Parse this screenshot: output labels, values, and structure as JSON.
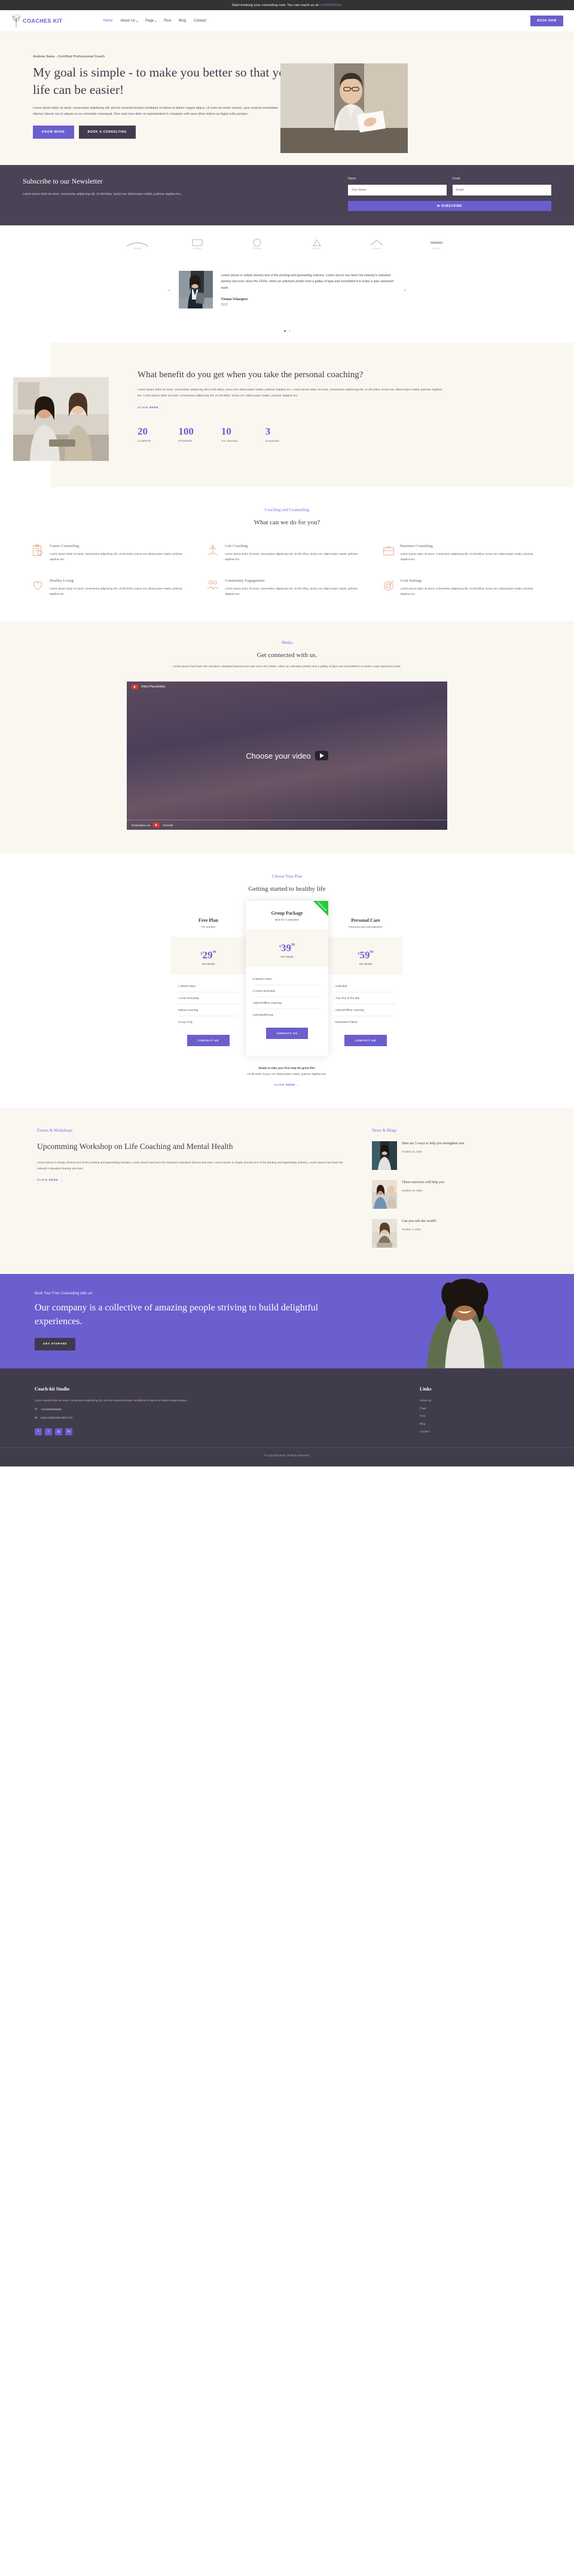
{
  "topbar": {
    "text": "Start booking your consulting now. You can reach us at: ",
    "phone": "+9190909009"
  },
  "header": {
    "logo_text": "COACHES KIT",
    "nav": [
      {
        "label": "Home",
        "active": true,
        "caret": false
      },
      {
        "label": "About Us",
        "active": false,
        "caret": true
      },
      {
        "label": "Page",
        "active": false,
        "caret": true
      },
      {
        "label": "Post",
        "active": false,
        "caret": false
      },
      {
        "label": "Blog",
        "active": false,
        "caret": false
      },
      {
        "label": "Contact",
        "active": false,
        "caret": false
      }
    ],
    "cta": "BOOK NOW"
  },
  "hero": {
    "eyebrow": "Andrew Sana – Certified Professional Coach",
    "title": "My goal is simple - to make you better so that your life can be easier!",
    "paragraph": "Lorem ipsum dolor sit amet, consectetur adipiscing elit, sed do eiusmod tempor incididunt ut labore et dolore magna aliqua. Ut enim ad minim veniam, quis nostrud exercitation ullamco laboris nisi ut aliquip ex ea commodo consequat. Duis aute irure dolor in reprehenderit in voluptate velit esse cillum dolore eu fugiat nulla pariatur.",
    "btn_primary": "KNOW MORE",
    "btn_secondary": "BOOK A CONSULTING"
  },
  "newsletter": {
    "title": "Subscribe to our Newsletter",
    "paragraph": "Lorem ipsum dolor sit amet, consectetur adipiscing elit. Ut elit tellus, luctus nec ullamcorper mattis, pulvinar dapibus leo.",
    "name_label": "Name",
    "name_placeholder": "Your Name",
    "email_label": "Email",
    "email_placeholder": "Email",
    "submit": "✉ SUBSCRIBE"
  },
  "testimonial": {
    "quote": "Lorem Ipsum is simply dummy text of the printing and typesetting industry. Lorem Ipsum has been the industry's standard dummy text ever since the 1500s, when an unknown printer took a galley of type and scrambled it to make a type specimen book.",
    "name": "Vienna Velasquez",
    "role": "CEO",
    "prev": "‹",
    "next": "›"
  },
  "benefit": {
    "title": "What benefit do you get when you take the personal coaching?",
    "paragraph": "Lorem ipsum dolor sit amet, consectetur adipiscing elit.Ut elit tellus, luctus nec ullamcorper mattis, pulvinar dapibus leo. Lorem ipsum dolor sit amet, consectetur adipiscing elit. Ut elit tellus, luctus nec ullamcorper mattis, pulvinar dapibus leo. Lorem ipsum dolor sit amet, consectetur adipiscing elit. Ut elit tellus, luctus nec ullamcorper mattis, pulvinar dapibus leo.",
    "link": "CLICK HERE →",
    "stats": [
      {
        "number": "20",
        "label": "CLIENTS"
      },
      {
        "number": "100",
        "label": "STORIES"
      },
      {
        "number": "10",
        "label": "Yrs Service"
      },
      {
        "number": "3",
        "label": "Countries"
      }
    ]
  },
  "services": {
    "eyebrow": "Coaching and Counselling",
    "title": "What can we do for you?",
    "items": [
      {
        "icon": "clipboard-icon",
        "title": "Career Counseling",
        "text": "Lorem ipsum dolor sit amet, consectetur adipiscing elit. Ut elit tellus, luctus nec ullamcorper mattis, pulvinar dapibus leo."
      },
      {
        "icon": "person-balance-icon",
        "title": "Life Coaching",
        "text": "Lorem ipsum dolor sit amet, consectetur adipiscing elit. Ut elit tellus, luctus nec ullamcorper mattis, pulvinar dapibus leo."
      },
      {
        "icon": "briefcase-icon",
        "title": "Business Consulting",
        "text": "Lorem ipsum dolor sit amet, consectetur adipiscing elit. Ut elit tellus, luctus nec ullamcorper mattis, pulvinar dapibus leo."
      },
      {
        "icon": "heart-icon",
        "title": "Healthy Living",
        "text": "Lorem ipsum dolor sit amet, consectetur adipiscing elit. Ut elit tellus, luctus nec ullamcorper mattis, pulvinar dapibus leo."
      },
      {
        "icon": "people-group-icon",
        "title": "Community Engagement",
        "text": "Lorem ipsum dolor sit amet, consectetur adipiscing elit. Ut elit tellus, luctus nec ullamcorper mattis, pulvinar dapibus leo."
      },
      {
        "icon": "target-icon",
        "title": "Goal Settings",
        "text": "Lorem ipsum dolor sit amet, consectetur adipiscing elit. Ut elit tellus, luctus nec ullamcorper mattis, pulvinar dapibus leo."
      }
    ]
  },
  "media": {
    "eyebrow": "Media",
    "title": "Get connected with us.",
    "paragraph": "Lorem Ipsum has been the industry's standard dummy text ever since the 1500s, when an unknown printer took a galley of type and scrambled it to make a type specimen book.",
    "video_label": "Video Placeholder",
    "video_center": "Choose your video",
    "video_footer": "Посмотреть на",
    "video_brand": "YouTube"
  },
  "pricing": {
    "eyebrow": "Choose Your Plan",
    "title": "Getting started to healthy life",
    "plans": [
      {
        "name": "Free Plan",
        "sub": "For starters",
        "currency": "$",
        "amount": "29",
        "cents": "99",
        "period": "Per Month",
        "features": [
          "1 Week Class",
          "1 Hour Everyday",
          "Online Learning",
          "Group Only"
        ],
        "cta": "CONTACT US",
        "ribbon": ""
      },
      {
        "name": "Group Package",
        "sub": "Best for Corporates",
        "currency": "$",
        "amount": "39",
        "cents": "99",
        "period": "Per Month",
        "features": [
          "6 Weeks Class",
          "2 Hours Everyday",
          "Online/Offline Learning",
          "Individual/Group"
        ],
        "cta": "CONTACT US",
        "ribbon": "POPULAR"
      },
      {
        "name": "Personal Care",
        "sub": "Personal care and attention",
        "currency": "$",
        "amount": "59",
        "cents": "99",
        "period": "Per Month",
        "features": [
          "Unlimited",
          "Any time of the day",
          "Online/Offline Learning",
          "Dedicated Trainer"
        ],
        "cta": "CONTACT US",
        "ribbon": ""
      }
    ],
    "ready_bold": "Ready to take your first step the great life?",
    "ready_text": "Ut elit tellus, luctus nec ullamcorper mattis, pulvinar dapibus leo.",
    "ready_link": "CLICK HERE →"
  },
  "events": {
    "eyebrow": "Events & Workshops",
    "title": "Upcomming Workshop on Life Coaching and Mental Health",
    "paragraph": "Lorem Ipsum is simply dummy text of the printing and typesetting industry. Lorem Ipsum has been the industry's standard dummy text ever. Lorem Ipsum is simply dummy text of the printing and typesetting industry. Lorem Ipsum has been the industry's standard dummy text ever.",
    "link": "CLICK HERE →"
  },
  "blogs": {
    "eyebrow": "News & Blogs",
    "items": [
      {
        "title": "Here are 5 ways to help you strengthen you",
        "date": "October 23, 2020"
      },
      {
        "title": "These exercises will help you",
        "date": "October 23, 2020"
      },
      {
        "title": "Can you rule the world?",
        "date": "October 1, 2020"
      }
    ]
  },
  "cta_banner": {
    "eyebrow": "Book Your Free Counselling with us!",
    "title": "Our company is a collective of amazing people striving to build delightful experiences.",
    "button": "GET STARTED"
  },
  "footer": {
    "title": "Coach-kit Studio",
    "paragraph": "Lorem ipsum dolor sit amet, consectetur adipiscing elit, sed do eiusmod tempor incididunt ut labore et dolore magna aliqua.",
    "phone": "+919090909090",
    "email": "HELLO@COACHKIT.CO",
    "links_title": "Links",
    "links": [
      "About Us",
      "Page",
      "Post",
      "Blog",
      "Contact"
    ],
    "socials": [
      "facebook-icon",
      "twitter-icon",
      "instagram-icon",
      "linkedin-icon"
    ],
    "copyright": "© Copyright 2020. All Right Reserved."
  },
  "colors": {
    "accent": "#6b5ece",
    "dark": "#413c4c",
    "cream": "#faf7f1",
    "green": "#25cc3f"
  }
}
